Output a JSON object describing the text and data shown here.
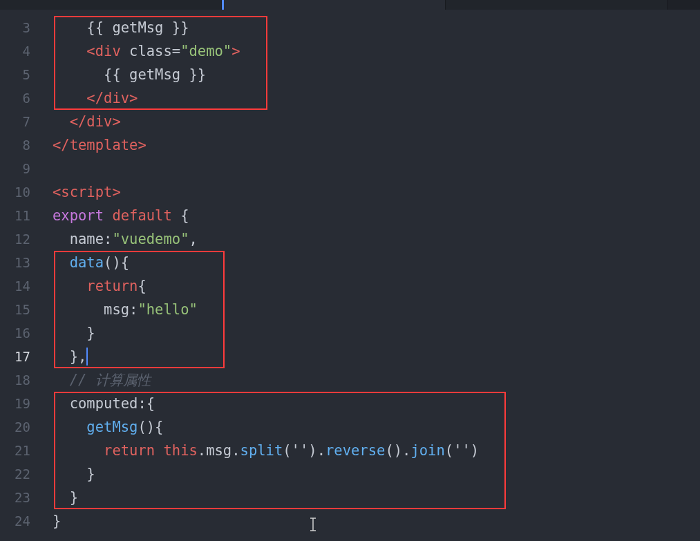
{
  "tabs": [
    {
      "selected": false
    },
    {
      "selected": true
    },
    {
      "selected": false
    }
  ],
  "blocks": [
    {
      "highlighted": true,
      "lines": [
        {
          "number": "3",
          "current": false,
          "cursor": false,
          "tokens": [
            {
              "kind": "plain",
              "text": "    {{ getMsg }}"
            }
          ]
        },
        {
          "number": "4",
          "current": false,
          "cursor": false,
          "tokens": [
            {
              "kind": "tag",
              "text": "    <div"
            },
            {
              "kind": "plain",
              "text": " class="
            },
            {
              "kind": "string",
              "text": "\"demo\""
            },
            {
              "kind": "tag",
              "text": ">"
            }
          ]
        },
        {
          "number": "5",
          "current": false,
          "cursor": false,
          "tokens": [
            {
              "kind": "plain",
              "text": "      {{ getMsg }}"
            }
          ]
        },
        {
          "number": "6",
          "current": false,
          "cursor": false,
          "tokens": [
            {
              "kind": "tag",
              "text": "    </div>"
            }
          ]
        }
      ]
    },
    {
      "highlighted": false,
      "lines": [
        {
          "number": "7",
          "current": false,
          "cursor": false,
          "tokens": [
            {
              "kind": "tag",
              "text": "  </div>"
            }
          ]
        },
        {
          "number": "8",
          "current": false,
          "cursor": false,
          "tokens": [
            {
              "kind": "tag",
              "text": "</template>"
            }
          ]
        },
        {
          "number": "9",
          "current": false,
          "cursor": false
        },
        {
          "number": "10",
          "current": false,
          "cursor": false,
          "tokens": [
            {
              "kind": "tag",
              "text": "<script>"
            }
          ]
        },
        {
          "number": "11",
          "current": false,
          "cursor": false,
          "tokens": [
            {
              "kind": "keyword",
              "text": "export"
            },
            {
              "kind": "tag",
              "text": " default"
            },
            {
              "kind": "plain",
              "text": " {"
            }
          ]
        },
        {
          "number": "12",
          "current": false,
          "cursor": false,
          "tokens": [
            {
              "kind": "plain",
              "text": "  name:"
            },
            {
              "kind": "string",
              "text": "\"vuedemo\""
            },
            {
              "kind": "plain",
              "text": ","
            }
          ]
        }
      ]
    },
    {
      "highlighted": true,
      "lines": [
        {
          "number": "13",
          "current": false,
          "cursor": false,
          "tokens": [
            {
              "kind": "function",
              "text": "  data"
            },
            {
              "kind": "plain",
              "text": "(){"
            }
          ]
        },
        {
          "number": "14",
          "current": false,
          "cursor": false,
          "tokens": [
            {
              "kind": "tag",
              "text": "    return"
            },
            {
              "kind": "plain",
              "text": "{"
            }
          ]
        },
        {
          "number": "15",
          "current": false,
          "cursor": false,
          "tokens": [
            {
              "kind": "plain",
              "text": "      msg:"
            },
            {
              "kind": "string",
              "text": "\"hello\""
            }
          ]
        },
        {
          "number": "16",
          "current": false,
          "cursor": false,
          "tokens": [
            {
              "kind": "plain",
              "text": "    }"
            }
          ]
        },
        {
          "number": "17",
          "current": true,
          "cursor": true,
          "tokens": [
            {
              "kind": "plain",
              "text": "  },"
            }
          ]
        }
      ]
    },
    {
      "highlighted": false,
      "lines": [
        {
          "number": "18",
          "current": false,
          "cursor": false,
          "tokens": [
            {
              "kind": "comment",
              "text": "  // 计算属性"
            }
          ]
        }
      ]
    },
    {
      "highlighted": true,
      "lines": [
        {
          "number": "19",
          "current": false,
          "cursor": false,
          "tokens": [
            {
              "kind": "plain",
              "text": "  computed:{"
            }
          ]
        },
        {
          "number": "20",
          "current": false,
          "cursor": false,
          "tokens": [
            {
              "kind": "function",
              "text": "    getMsg"
            },
            {
              "kind": "plain",
              "text": "(){"
            }
          ]
        },
        {
          "number": "21",
          "current": false,
          "cursor": false,
          "tokens": [
            {
              "kind": "tag",
              "text": "      return this"
            },
            {
              "kind": "plain",
              "text": ".msg."
            },
            {
              "kind": "function",
              "text": "split"
            },
            {
              "kind": "plain",
              "text": "('')."
            },
            {
              "kind": "function",
              "text": "reverse"
            },
            {
              "kind": "plain",
              "text": "()."
            },
            {
              "kind": "function",
              "text": "join"
            },
            {
              "kind": "plain",
              "text": "('')"
            }
          ]
        },
        {
          "number": "22",
          "current": false,
          "cursor": false,
          "tokens": [
            {
              "kind": "plain",
              "text": "    }"
            }
          ]
        },
        {
          "number": "23",
          "current": false,
          "cursor": false,
          "tokens": [
            {
              "kind": "plain",
              "text": "  }"
            }
          ]
        }
      ]
    },
    {
      "highlighted": false,
      "lines": [
        {
          "number": "24",
          "current": false,
          "cursor": false,
          "tokens": [
            {
              "kind": "plain",
              "text": "}"
            }
          ]
        }
      ]
    }
  ]
}
